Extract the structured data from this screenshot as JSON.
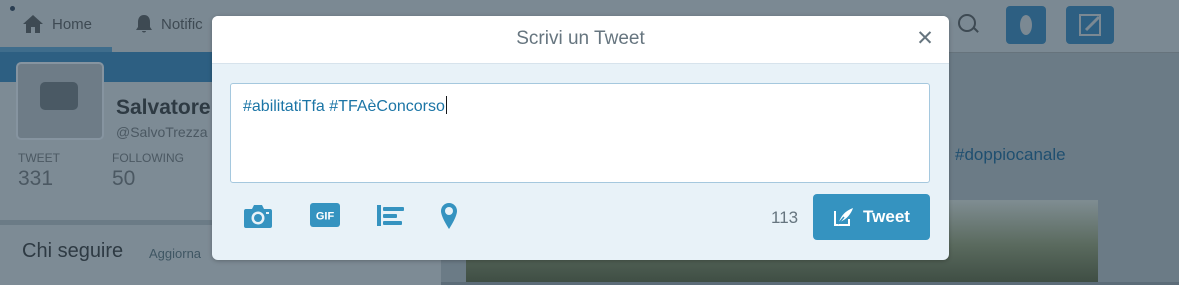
{
  "background": {
    "nav": {
      "home": "Home",
      "notifications": "Notific"
    },
    "profile": {
      "name": "Salvatore",
      "handle": "@SalvoTrezza",
      "tweets_label": "TWEET",
      "tweets_value": "331",
      "following_label": "FOLLOWING",
      "following_value": "50"
    },
    "who_to_follow": {
      "title": "Chi seguire",
      "refresh": "Aggiorna"
    },
    "hashtag": "#doppiocanale"
  },
  "modal": {
    "title": "Scrivi un Tweet",
    "close_icon": "close-icon",
    "tweet_text": "#abilitatiTfa #TFAèConcorso",
    "toolbar": {
      "photo_icon": "camera-icon",
      "gif_label": "GIF",
      "poll_icon": "poll-icon",
      "location_icon": "location-pin-icon"
    },
    "char_counter": "113",
    "tweet_button_label": "Tweet"
  },
  "colors": {
    "accent": "#3593c0",
    "modal_bg": "#e8f2f8",
    "hashtag_text": "#1b75a6",
    "icon": "#3593c0"
  }
}
